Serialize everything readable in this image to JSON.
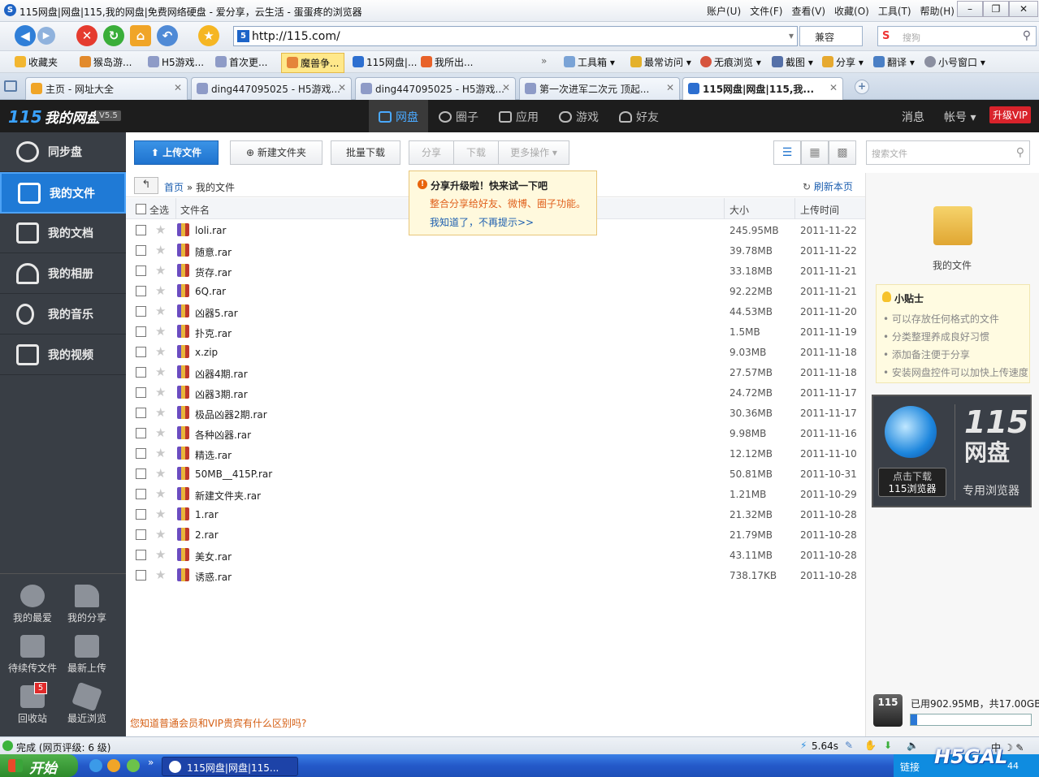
{
  "window": {
    "title": "115网盘|网盘|115,我的网盘|免费网络硬盘 - 爱分享，云生活 - 蛋蛋疼的浏览器",
    "menu": [
      "账户(U)",
      "文件(F)",
      "查看(V)",
      "收藏(O)",
      "工具(T)",
      "帮助(H)"
    ]
  },
  "nav": {
    "url": "http://115.com/",
    "compat": "兼容",
    "search_placeholder": "搜狗"
  },
  "favorites": {
    "items": [
      "收藏夹",
      "猴岛游...",
      "H5游戏...",
      "首次更...",
      "魔兽争...",
      "115网盘|...",
      "我所出..."
    ],
    "tools": [
      "工具箱",
      "最常访问",
      "无痕浏览",
      "截图",
      "分享",
      "翻译",
      "小号窗口"
    ]
  },
  "tabs": [
    {
      "label": "主页 - 网址大全"
    },
    {
      "label": "ding447095025 - H5游戏..."
    },
    {
      "label": "ding447095025 - H5游戏..."
    },
    {
      "label": "第一次进军二次元 顶起..."
    },
    {
      "label": "115网盘|网盘|115,我..."
    }
  ],
  "app": {
    "brand": "我的网盘",
    "brand_num": "115",
    "version": "V5.5",
    "topnav": [
      "网盘",
      "圈子",
      "应用",
      "游戏",
      "好友"
    ],
    "messages": "消息",
    "account": "帐号 ▾",
    "vip": "升级VIP"
  },
  "sidebar": {
    "items": [
      "同步盘",
      "我的文件",
      "我的文档",
      "我的相册",
      "我的音乐",
      "我的视频"
    ],
    "bottom": [
      "我的最爱",
      "我的分享",
      "待续传文件",
      "最新上传",
      "回收站",
      "最近浏览"
    ],
    "trash_count": "5"
  },
  "toolbar": {
    "upload": "上传文件",
    "new_folder": "新建文件夹",
    "batch_download": "批量下载",
    "share": "分享",
    "download": "下载",
    "more": "更多操作 ▾",
    "search_placeholder": "搜索文件"
  },
  "breadcrumb": {
    "home": "首页",
    "sep": "»",
    "current": "我的文件",
    "refresh": "刷新本页"
  },
  "tooltip": {
    "title": "分享升级啦！快来试一下吧",
    "desc": "整合分享给好友、微博、圈子功能。",
    "dismiss": "我知道了，不再提示>>"
  },
  "table": {
    "headers": {
      "select_all": "全选",
      "name": "文件名",
      "size": "大小",
      "time": "上传时间"
    },
    "rows": [
      {
        "name": "loli.rar",
        "size": "245.95MB",
        "date": "2011-11-22"
      },
      {
        "name": "随意.rar",
        "size": "39.78MB",
        "date": "2011-11-22"
      },
      {
        "name": "货存.rar",
        "size": "33.18MB",
        "date": "2011-11-21"
      },
      {
        "name": "6Q.rar",
        "size": "92.22MB",
        "date": "2011-11-21"
      },
      {
        "name": "凶器5.rar",
        "size": "44.53MB",
        "date": "2011-11-20"
      },
      {
        "name": "扑克.rar",
        "size": "1.5MB",
        "date": "2011-11-19"
      },
      {
        "name": "x.zip",
        "size": "9.03MB",
        "date": "2011-11-18"
      },
      {
        "name": "凶器4期.rar",
        "size": "27.57MB",
        "date": "2011-11-18"
      },
      {
        "name": "凶器3期.rar",
        "size": "24.72MB",
        "date": "2011-11-17"
      },
      {
        "name": "极品凶器2期.rar",
        "size": "30.36MB",
        "date": "2011-11-17"
      },
      {
        "name": "各种凶器.rar",
        "size": "9.98MB",
        "date": "2011-11-16"
      },
      {
        "name": "精选.rar",
        "size": "12.12MB",
        "date": "2011-11-10"
      },
      {
        "name": "50MB__415P.rar",
        "size": "50.81MB",
        "date": "2011-10-31"
      },
      {
        "name": "新建文件夹.rar",
        "size": "1.21MB",
        "date": "2011-10-29"
      },
      {
        "name": "1.rar",
        "size": "21.32MB",
        "date": "2011-10-28"
      },
      {
        "name": "2.rar",
        "size": "21.79MB",
        "date": "2011-10-28"
      },
      {
        "name": "美女.rar",
        "size": "43.11MB",
        "date": "2011-10-28"
      },
      {
        "name": "诱惑.rar",
        "size": "738.17KB",
        "date": "2011-10-28"
      }
    ]
  },
  "right": {
    "folder_label": "我的文件",
    "tips_title": "小贴士",
    "tips": [
      "可以存放任何格式的文件",
      "分类整理养成良好习惯",
      "添加备注便于分享",
      "安装网盘控件可以加快上传速度"
    ],
    "promo_dl": "点击下载",
    "promo_dl2": "115浏览器",
    "promo_big": "115",
    "promo_big2": "网盘",
    "promo_sub": "专用浏览器",
    "storage_logo": "115",
    "storage_text": "已用902.95MB，共17.00GB",
    "storage_used_fraction": 0.052
  },
  "footer_link": "您知道普通会员和VIP贵宾有什么区别吗?",
  "status": {
    "text": "完成 (网页评级: 6 级)",
    "time": "5.64s"
  },
  "taskbar": {
    "start": "开始",
    "item": "115网盘|网盘|115...",
    "link": "链接",
    "clock": "44"
  },
  "watermark": "H5GAL"
}
